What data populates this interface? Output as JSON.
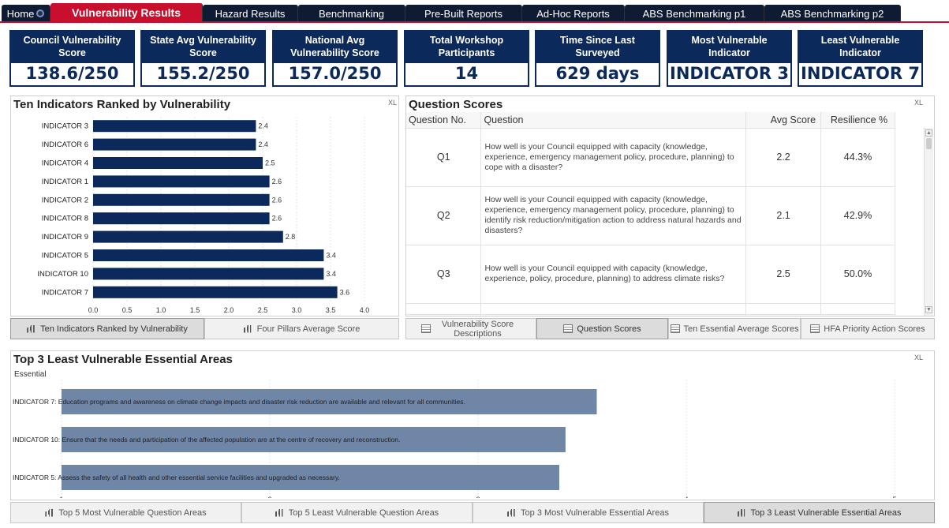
{
  "tabs": [
    {
      "label": "Home",
      "active": false
    },
    {
      "label": "Vulnerability Results",
      "active": true
    },
    {
      "label": "Hazard Results",
      "active": false
    },
    {
      "label": "Benchmarking",
      "active": false
    },
    {
      "label": "Pre-Built Reports",
      "active": false
    },
    {
      "label": "Ad-Hoc Reports",
      "active": false
    },
    {
      "label": "ABS Benchmarking p1",
      "active": false
    },
    {
      "label": "ABS Benchmarking p2",
      "active": false
    }
  ],
  "kpis": [
    {
      "title": "Council Vulnerability Score",
      "value": "138.6/250"
    },
    {
      "title": "State Avg Vulnerability Score",
      "value": "155.2/250"
    },
    {
      "title": "National Avg Vulnerability Score",
      "value": "157.0/250"
    },
    {
      "title": "Total Workshop Participants",
      "value": "14"
    },
    {
      "title": "Time Since Last Surveyed",
      "value": "629 days"
    },
    {
      "title": "Most Vulnerable Indicator",
      "value": "INDICATOR 3"
    },
    {
      "title": "Least Vulnerable Indicator",
      "value": "INDICATOR 7"
    }
  ],
  "ranked_panel": {
    "title": "Ten Indicators Ranked by Vulnerability",
    "xl": "XL",
    "buttons": [
      "Ten Indicators Ranked by Vulnerability",
      "Four Pillars Average Score"
    ]
  },
  "question_panel": {
    "title": "Question Scores",
    "xl": "XL",
    "columns": [
      "Question No.",
      "Question",
      "Avg Score",
      "Resilience %"
    ],
    "rows": [
      {
        "no": "Q1",
        "question": "How well is your Council equipped with capacity (knowledge, experience, emergency management policy, procedure, planning) to cope with a disaster?",
        "avg": "2.2",
        "res": "44.3%"
      },
      {
        "no": "Q2",
        "question": "How well is your Council equipped with capacity (knowledge, experience, emergency management policy, procedure, planning) to identify risk reduction/mitigation action to address natural hazards and disasters?",
        "avg": "2.1",
        "res": "42.9%"
      },
      {
        "no": "Q3",
        "question": "How well is your Council equipped with capacity (knowledge, experience, policy, procedure, planning) to address climate risks?",
        "avg": "2.5",
        "res": "50.0%"
      }
    ],
    "buttons": [
      "Vulnerability Score Descriptions",
      "Question Scores",
      "Ten Essential Average Scores",
      "HFA Priority Action Scores"
    ]
  },
  "bottom_panel": {
    "title": "Top 3 Least Vulnerable Essential Areas",
    "xl": "XL",
    "legend_label": "Essential",
    "buttons": [
      "Top 5 Most Vulnerable Question Areas",
      "Top 5 Least Vulnerable Question Areas",
      "Top 3 Most Vulnerable Essential Areas",
      "Top 3 Least Vulnerable Essential Areas"
    ]
  },
  "chart_data": [
    {
      "type": "bar",
      "orientation": "horizontal",
      "title": "Ten Indicators Ranked by Vulnerability",
      "categories": [
        "INDICATOR 3",
        "INDICATOR 6",
        "INDICATOR 4",
        "INDICATOR 1",
        "INDICATOR 2",
        "INDICATOR 8",
        "INDICATOR 9",
        "INDICATOR 5",
        "INDICATOR 10",
        "INDICATOR 7"
      ],
      "values": [
        2.4,
        2.4,
        2.5,
        2.6,
        2.6,
        2.6,
        2.8,
        3.4,
        3.4,
        3.6
      ],
      "data_labels": [
        "2.4",
        "2.4",
        "2.5",
        "2.6",
        "2.6",
        "2.6",
        "2.8",
        "3.4",
        "3.4",
        "3.6"
      ],
      "xlim": [
        0,
        4.0
      ],
      "xticks": [
        "0.0",
        "0.5",
        "1.0",
        "1.5",
        "2.0",
        "2.5",
        "3.0",
        "3.5",
        "4.0"
      ],
      "bar_color": "#0b2a5b",
      "grid": true
    },
    {
      "type": "bar",
      "orientation": "horizontal",
      "title": "Top 3 Least Vulnerable Essential Areas",
      "categories": [
        "INDICATOR 7: Education programs and awareness on climate change impacts and disaster risk reduction are available and relevant for all communities.",
        "INDICATOR 10: Ensure that the needs and participation of the affected population are at the centre of recovery and reconstruction.",
        "INDICATOR 5: Assess the safety of all health and other essential service facilities and upgraded as necessary."
      ],
      "values": [
        3.57,
        3.42,
        3.39
      ],
      "xlim": [
        1,
        5
      ],
      "xticks": [
        "1",
        "2",
        "3",
        "4",
        "5"
      ],
      "bar_color": "#6f86a6",
      "grid": true
    }
  ],
  "colors": {
    "tab": "#0f1a33",
    "active_tab": "#c8102e",
    "kpi": "#0b2a5b"
  }
}
